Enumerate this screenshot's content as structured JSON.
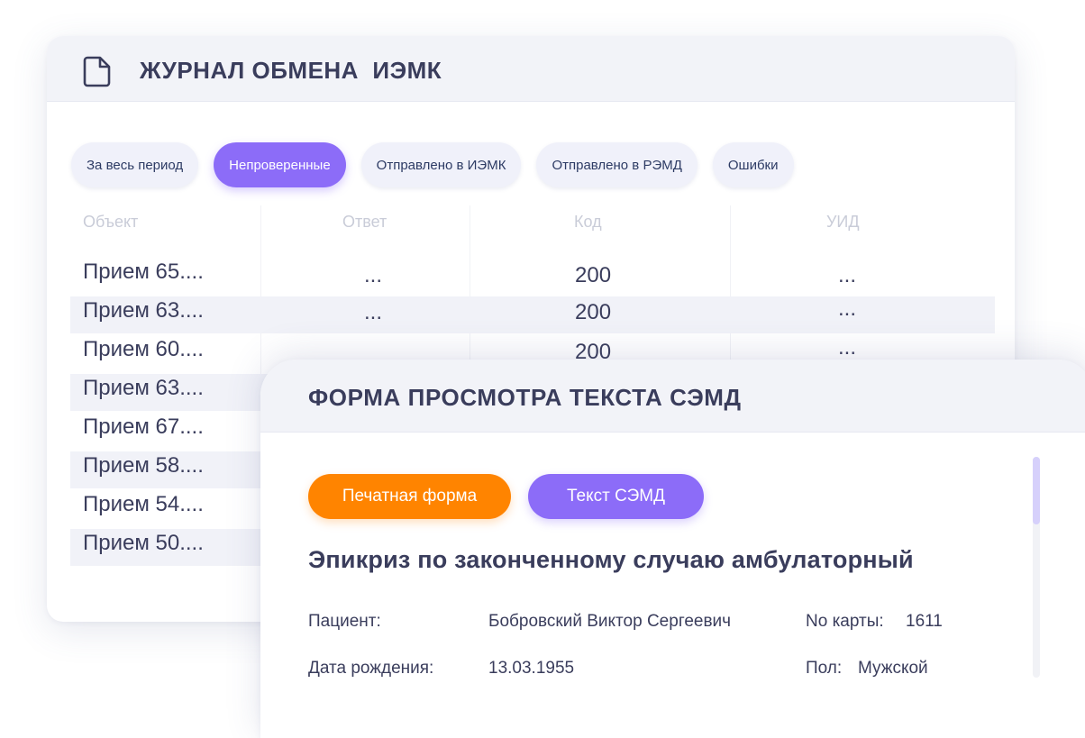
{
  "journal": {
    "title": "ЖУРНАЛ ОБМЕНА  ИЭМК",
    "icon": "document-icon",
    "filters": [
      {
        "label": "За весь период",
        "active": false
      },
      {
        "label": "Непроверенные",
        "active": true
      },
      {
        "label": "Отправлено в ИЭМК",
        "active": false
      },
      {
        "label": "Отправлено в РЭМД",
        "active": false
      },
      {
        "label": "Ошибки",
        "active": false
      }
    ],
    "columns": [
      "Объект",
      "Ответ",
      "Код",
      "УИД"
    ],
    "rows": [
      {
        "object": "Прием 65....",
        "answer": "...",
        "code": "200",
        "uid": "..."
      },
      {
        "object": "Прием 63....",
        "answer": "...",
        "code": "200",
        "uid": "..."
      },
      {
        "object": "Прием 60....",
        "answer": "",
        "code": "200",
        "uid": "..."
      },
      {
        "object": "Прием 63....",
        "answer": "",
        "code": "",
        "uid": ""
      },
      {
        "object": "Прием 67....",
        "answer": "",
        "code": "",
        "uid": ""
      },
      {
        "object": "Прием 58....",
        "answer": "",
        "code": "",
        "uid": ""
      },
      {
        "object": "Прием 54....",
        "answer": "",
        "code": "",
        "uid": ""
      },
      {
        "object": "Прием 50....",
        "answer": "",
        "code": "",
        "uid": ""
      }
    ]
  },
  "form": {
    "title": "ФОРМА ПРОСМОТРА ТЕКСТА СЭМД",
    "print_button": "Печатная форма",
    "text_button": "Текст СЭМД",
    "heading": "Эпикриз по законченному случаю амбулаторный",
    "patient_label": "Пациент:",
    "patient_value": "Бобровский Виктор Сергеевич",
    "card_label": "No карты:",
    "card_value": "1611",
    "birth_label": "Дата рождения:",
    "birth_value": "13.03.1955",
    "sex_label": "Пол:",
    "sex_value": "Мужской"
  },
  "colors": {
    "accent_purple": "#8c6cf8",
    "accent_orange": "#ff8400",
    "text_dark": "#3a3d5c",
    "header_bg": "#f2f3f8"
  }
}
